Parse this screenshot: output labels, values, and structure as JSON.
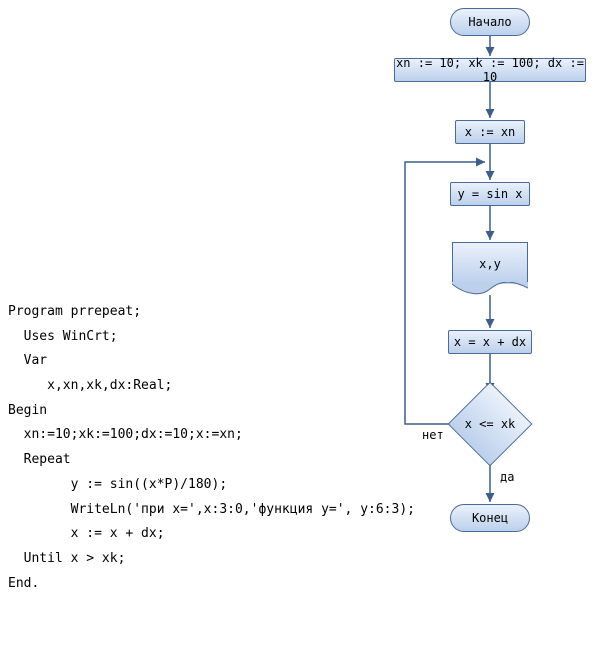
{
  "code": {
    "l1": "Program prrepeat;",
    "l2": "  Uses WinCrt;",
    "l3": "  Var",
    "l4": "     x,xn,xk,dx:Real;",
    "l5": "Begin",
    "l6": "  xn:=10;xk:=100;dx:=10;x:=xn;",
    "l7": "  Repeat",
    "l8": "        y := sin((x*P)/180);",
    "l9": "        WriteLn('при x=',x:3:0,'функция y=', y:6:3);",
    "l10": "        x := x + dx;",
    "l11": "  Until x > xk;",
    "l12": "End."
  },
  "flow": {
    "start": "Начало",
    "init": "xn := 10; xk := 100; dx :=  10",
    "assign": "x := xn",
    "calc": "y = sin x",
    "output": "x,y",
    "incr": "x = x + dx",
    "cond": "x <= xk",
    "yes": "да",
    "no": "нет",
    "end": "Конец"
  },
  "colors": {
    "stroke": "#4a6a9a",
    "arrow": "#3b5e8e"
  }
}
